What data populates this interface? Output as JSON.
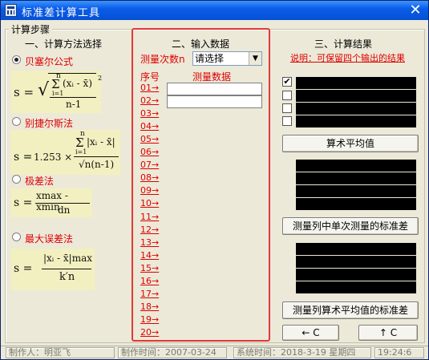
{
  "window": {
    "title": "标准差计算工具",
    "close_glyph": "✕"
  },
  "steps_group": {
    "label": "计算步骤"
  },
  "methods": {
    "title": "一、计算方法选择",
    "items": [
      {
        "label": "贝塞尔公式",
        "checked": true
      },
      {
        "label": "别捷尔斯法",
        "checked": false
      },
      {
        "label": "极差法",
        "checked": false
      },
      {
        "label": "最大误差法",
        "checked": false
      }
    ],
    "formula_bessel": {
      "lhs": "s =",
      "sum_top": "n",
      "sum_bottom": "i=1",
      "term": "(xᵢ - x̄)",
      "power": "2",
      "denominator": "n-1"
    },
    "formula_peters": {
      "lhs": "s =",
      "coef": "1.253 ×",
      "sum_top": "n",
      "sum_bottom": "i=1",
      "term": "|xᵢ - x̄|",
      "denominator": "√n(n-1)"
    },
    "formula_range": {
      "lhs": "s =",
      "numerator": "xmax - xmin",
      "denominator": "dn"
    },
    "formula_max_error": {
      "lhs": "s =",
      "numerator": "|xᵢ - x̄|max",
      "denominator": "k′n"
    }
  },
  "input": {
    "title": "二、输入数据",
    "count_label": "测量次数n",
    "count_select": "请选择",
    "seq_header": "序号",
    "data_header": "测量数据",
    "rows": [
      "01→",
      "02→",
      "03→",
      "04→",
      "05→",
      "06→",
      "07→",
      "08→",
      "09→",
      "10→",
      "11→",
      "12→",
      "13→",
      "14→",
      "15→",
      "16→",
      "17→",
      "18→",
      "19→",
      "20→"
    ]
  },
  "results": {
    "title": "三、计算结果",
    "note": "说明：可保留四个输出的结果",
    "checks": [
      true,
      false,
      false,
      false
    ],
    "btn_mean": "算术平均值",
    "btn_single_sd": "测量列中单次测量的标准差",
    "btn_mean_sd": "测量列算术平均值的标准差",
    "btn_left": "← C",
    "btn_up": "↑ C"
  },
  "status": {
    "author": "制作人：明亚飞",
    "made_time": "制作时间：2007-03-24",
    "sys_date": "系统时间：2018-3-19  星期四",
    "sys_time": "19:24:6"
  }
}
